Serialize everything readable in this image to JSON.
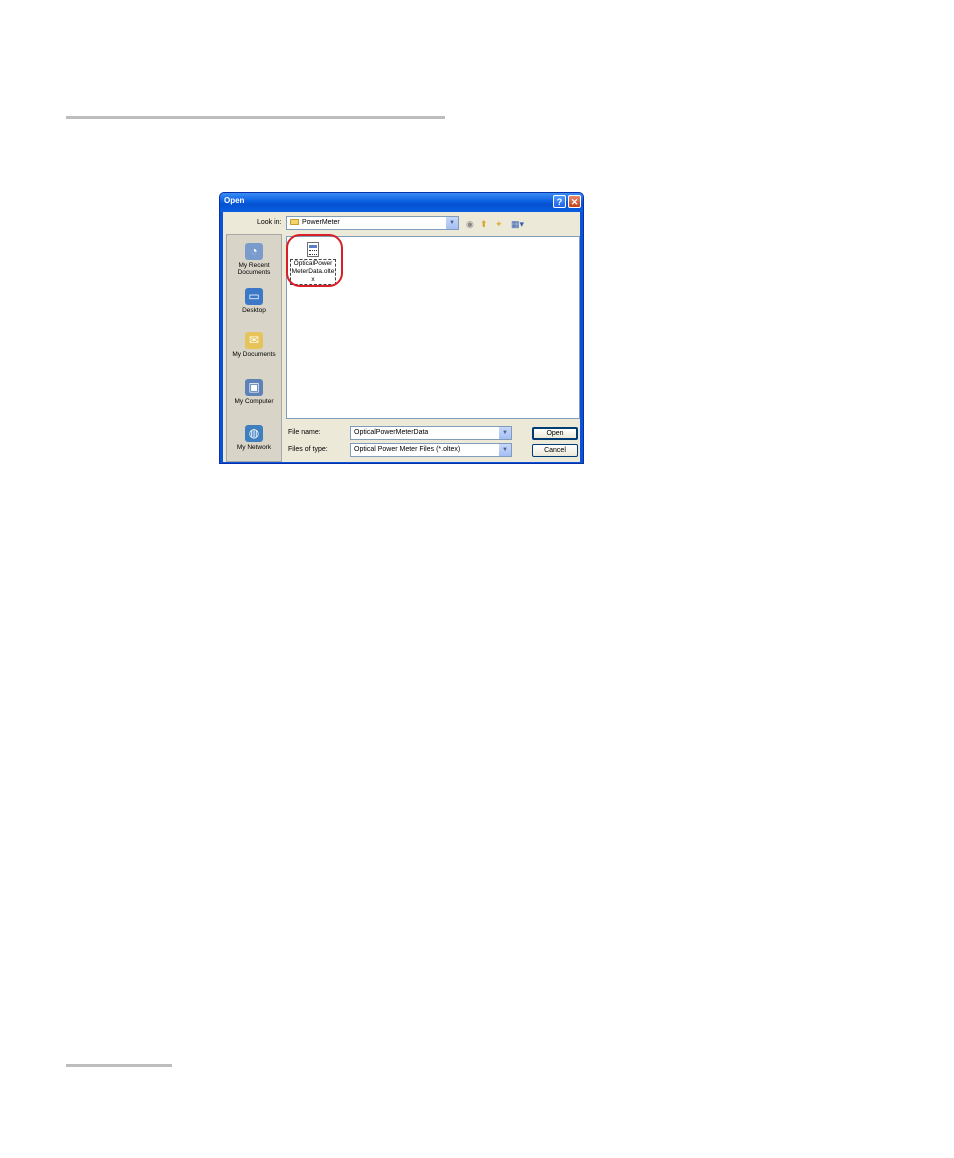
{
  "dialog": {
    "title": "Open",
    "help_glyph": "?",
    "close_glyph": "✕",
    "look_in_label": "Look in:",
    "look_in_value": "PowerMeter",
    "toolbar_icons": [
      "back-icon",
      "up-folder-icon",
      "new-folder-icon",
      "view-menu-icon"
    ],
    "places": [
      {
        "label": "My Recent Documents",
        "icon": "recent-documents-icon"
      },
      {
        "label": "Desktop",
        "icon": "desktop-icon"
      },
      {
        "label": "My Documents",
        "icon": "my-documents-icon"
      },
      {
        "label": "My Computer",
        "icon": "my-computer-icon"
      },
      {
        "label": "My Network",
        "icon": "my-network-icon"
      }
    ],
    "files": [
      {
        "name": "OpticalPowerMeterData.oltex",
        "highlighted": true
      }
    ],
    "file_name_label": "File name:",
    "file_name_value": "OpticalPowerMeterData",
    "file_type_label": "Files of type:",
    "file_type_value": "Optical Power Meter Files (*.oltex)",
    "open_button": "Open",
    "cancel_button": "Cancel"
  },
  "colors": {
    "title_bar": "#0a53d8",
    "highlight_ring": "#d81f26",
    "dialog_body": "#ece9d8"
  }
}
